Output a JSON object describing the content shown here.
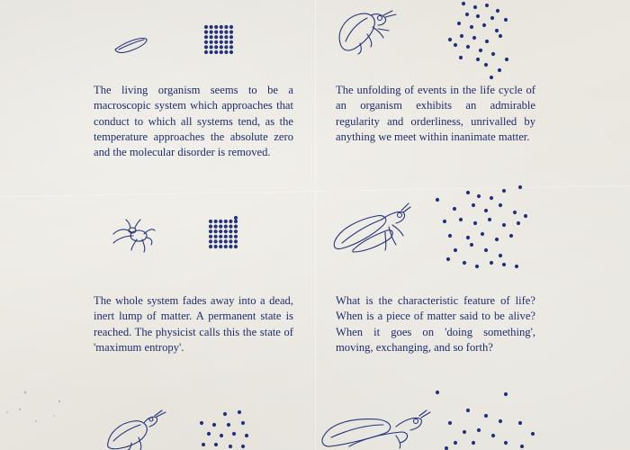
{
  "accent_color": "#25347a",
  "background_color": "#ebe8e1",
  "paragraphs": [
    {
      "text": "The living organism seems to be a macroscopic system which approaches that conduct to which all systems tend, as the temperature approaches the absolute zero and the molecular disorder is removed."
    },
    {
      "text": "The unfolding of events in the life cycle of an organism exhibits an admirable regularity and orderliness, unrivalled by anything we meet within inanimate matter."
    },
    {
      "text": "The whole system fades away into  a dead, inert lump of matter. A permanent state is reached. The physicist calls this the state of 'maximum entropy'."
    },
    {
      "text": "What is the characteristic feature of life? When is a piece of matter said to be alive? When it goes on 'doing something', moving, exchanging, and so forth?"
    }
  ],
  "illustrations": [
    {
      "organism": "seed-icon",
      "particles": "ordered-grid"
    },
    {
      "organism": "cicada-icon",
      "particles": "scattered"
    },
    {
      "organism": "spider-icon",
      "particles": "ordered-grid"
    },
    {
      "organism": "winged-insect-icon",
      "particles": "scattered"
    },
    {
      "organism": "beetle-icon",
      "particles": "loose-cluster"
    },
    {
      "organism": "dragonfly-icon",
      "particles": "scattered"
    }
  ]
}
